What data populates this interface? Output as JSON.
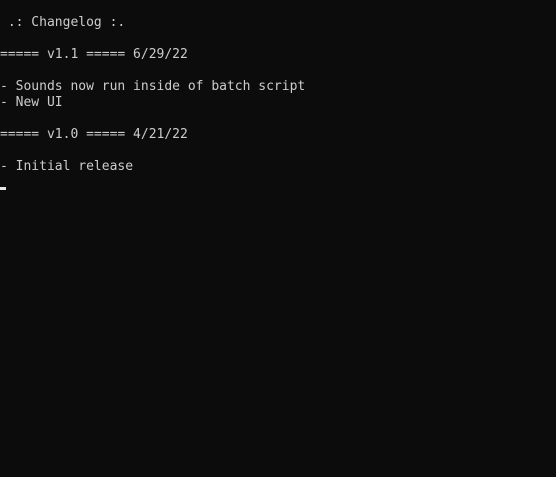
{
  "console": {
    "title": " .: Changelog :.",
    "lines": [
      "===== v1.1 ===== 6/29/22",
      "- Sounds now run inside of batch script",
      "- New UI",
      "===== v1.0 ===== 4/21/22",
      "- Initial release"
    ]
  },
  "colors": {
    "background": "#0c0c0c",
    "text": "#cccccc",
    "cursor": "#e6e6e6"
  }
}
